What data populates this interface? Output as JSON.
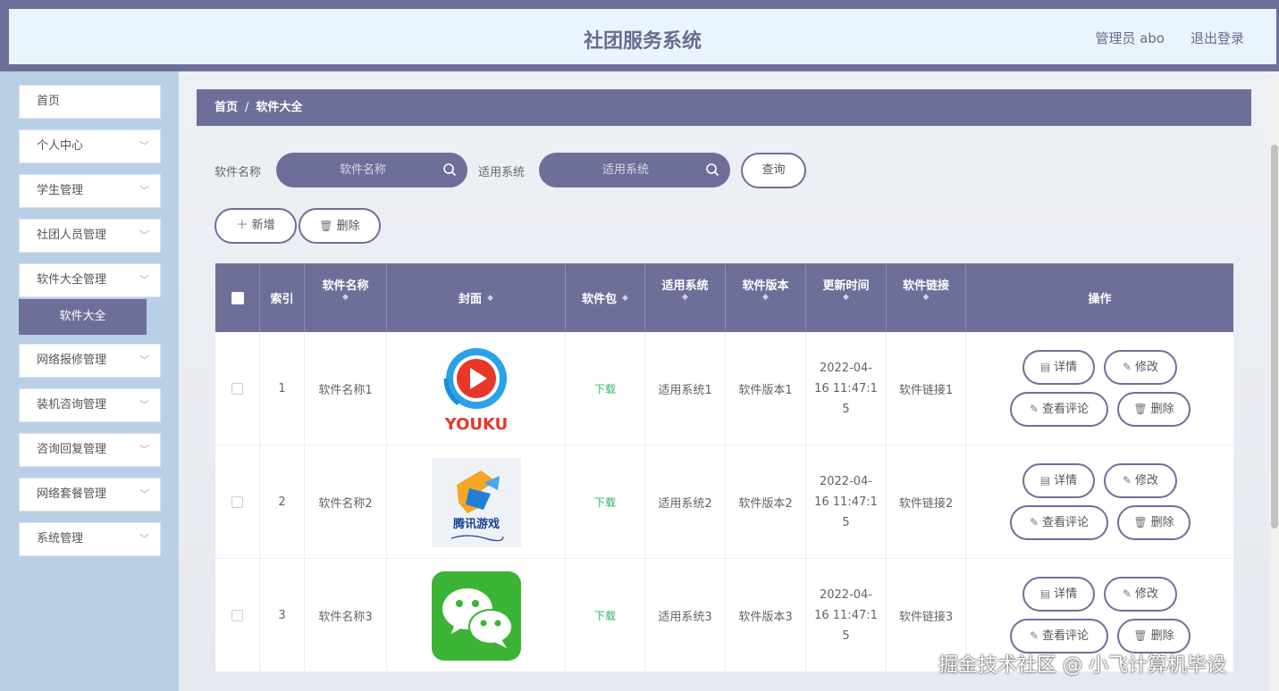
{
  "header": {
    "title": "社团服务系统",
    "admin": "管理员 abo",
    "logout": "退出登录"
  },
  "sidebar": {
    "items": [
      {
        "label": "首页",
        "chevron": false
      },
      {
        "label": "个人中心",
        "chevron": true
      },
      {
        "label": "学生管理",
        "chevron": true
      },
      {
        "label": "社团人员管理",
        "chevron": true
      },
      {
        "label": "软件大全管理",
        "chevron": true
      },
      {
        "label": "网络报修管理",
        "chevron": true
      },
      {
        "label": "装机咨询管理",
        "chevron": true
      },
      {
        "label": "咨询回复管理",
        "chevron": true
      },
      {
        "label": "网络套餐管理",
        "chevron": true
      },
      {
        "label": "系统管理",
        "chevron": true
      }
    ],
    "active_sub": "软件大全"
  },
  "breadcrumb": {
    "home": "首页",
    "sep": "/",
    "current": "软件大全"
  },
  "search": {
    "name_label": "软件名称",
    "name_placeholder": "软件名称",
    "system_label": "适用系统",
    "system_placeholder": "适用系统",
    "query_button": "查询"
  },
  "toolbar": {
    "add": "新增",
    "delete": "删除"
  },
  "table": {
    "headers": [
      "索引",
      "软件名称",
      "封面",
      "软件包",
      "适用系统",
      "软件版本",
      "更新时间",
      "软件链接",
      "操作"
    ],
    "rows": [
      {
        "index": "1",
        "name": "软件名称1",
        "package": "下载",
        "system": "适用系统1",
        "version": "软件版本1",
        "time_line1": "2022-04-",
        "time_line2": "16 11:47:1",
        "time_line3": "5",
        "link": "软件链接1",
        "cover_text": "YOUKU"
      },
      {
        "index": "2",
        "name": "软件名称2",
        "package": "下载",
        "system": "适用系统2",
        "version": "软件版本2",
        "time_line1": "2022-04-",
        "time_line2": "16 11:47:1",
        "time_line3": "5",
        "link": "软件链接2",
        "cover_text": "腾讯游戏"
      },
      {
        "index": "3",
        "name": "软件名称3",
        "package": "下载",
        "system": "适用系统3",
        "version": "软件版本3",
        "time_line1": "2022-04-",
        "time_line2": "16 11:47:1",
        "time_line3": "5",
        "link": "软件链接3",
        "cover_text": ""
      }
    ],
    "actions": {
      "detail": "详情",
      "edit": "修改",
      "comments": "查看评论",
      "delete": "删除"
    }
  },
  "watermark": "掘金技术社区 @ 小飞计算机毕设",
  "colors": {
    "accent": "#6e6f99",
    "header_bg": "#eaf4fc",
    "sidebar_bg": "#b9cfe6",
    "download": "#2fb36a"
  }
}
